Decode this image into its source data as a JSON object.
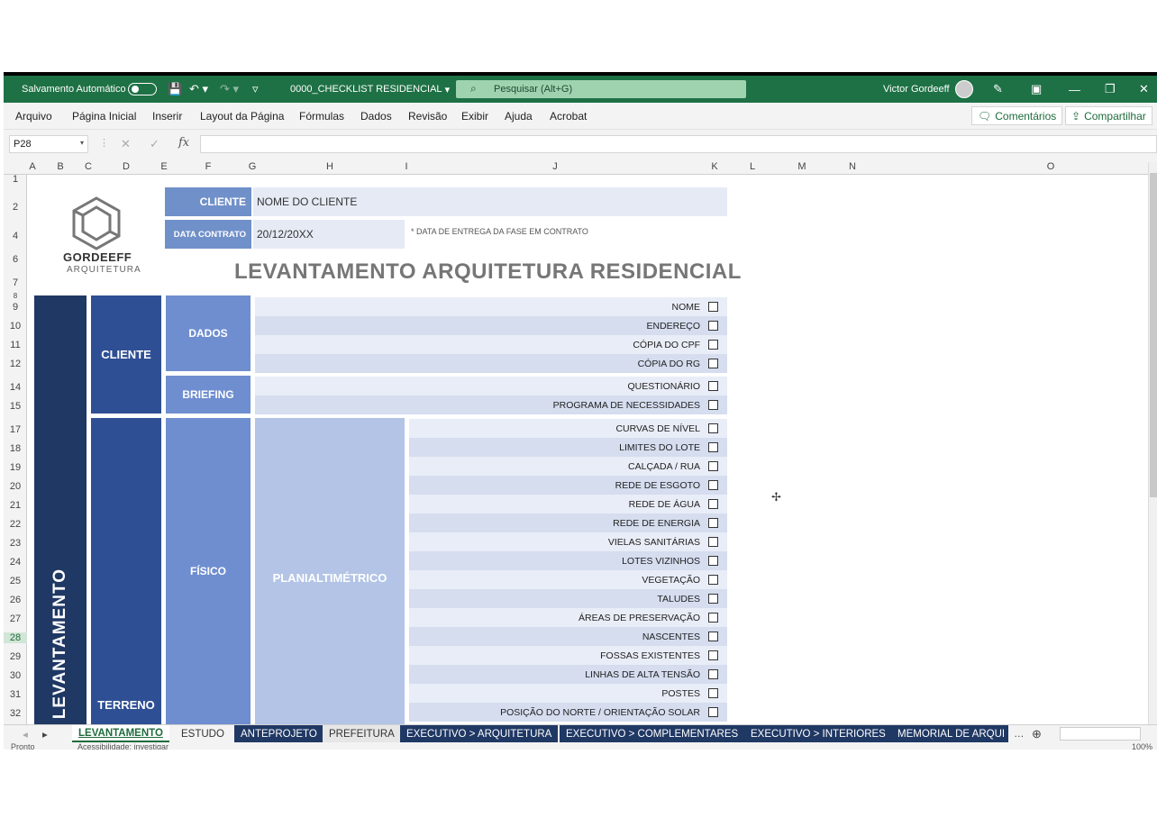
{
  "titlebar": {
    "autosave_label": "Salvamento Automático",
    "filename": "0000_CHECKLIST RESIDENCIAL",
    "filename_caret": "▾",
    "search_placeholder": "Pesquisar (Alt+G)",
    "user_name": "Victor Gordeeff"
  },
  "menu": {
    "items": [
      "Arquivo",
      "Página Inicial",
      "Inserir",
      "Layout da Página",
      "Fórmulas",
      "Dados",
      "Revisão",
      "Exibir",
      "Ajuda",
      "Acrobat"
    ],
    "comments_label": "Comentários",
    "share_label": "Compartilhar"
  },
  "formula_bar": {
    "name_box": "P28",
    "fx_label": "fx",
    "value": ""
  },
  "columns": [
    "A",
    "B",
    "C",
    "D",
    "E",
    "F",
    "G",
    "H",
    "I",
    "J",
    "K",
    "L",
    "M",
    "N",
    "O"
  ],
  "rows": [
    "1",
    "2",
    "4",
    "6",
    "7",
    "8",
    "9",
    "10",
    "11",
    "12",
    "14",
    "15",
    "17",
    "18",
    "19",
    "20",
    "21",
    "22",
    "23",
    "24",
    "25",
    "26",
    "27",
    "28",
    "29",
    "30",
    "31",
    "32"
  ],
  "sheet": {
    "logo_name": "GORDEEFF",
    "logo_sub": "ARQUITETURA",
    "client_label": "CLIENTE",
    "client_value": "NOME DO CLIENTE",
    "date_label": "DATA CONTRATO",
    "date_value": "20/12/20XX",
    "date_note": "* DATA DE ENTREGA DA FASE EM CONTRATO",
    "title": "LEVANTAMENTO ARQUITETURA RESIDENCIAL",
    "phase": "LEVANTAMENTO",
    "group_cliente": "CLIENTE",
    "group_terreno": "TERRENO",
    "sub_dados": "DADOS",
    "sub_briefing": "BRIEFING",
    "sub_fisico": "FÍSICO",
    "sub_planialtimetrico": "PLANIALTIMÉTRICO",
    "dados_items": [
      "NOME",
      "ENDEREÇO",
      "CÓPIA DO CPF",
      "CÓPIA DO RG"
    ],
    "briefing_items": [
      "QUESTIONÁRIO",
      "PROGRAMA DE NECESSIDADES"
    ],
    "fisico_items": [
      "CURVAS DE NÍVEL",
      "LIMITES DO LOTE",
      "CALÇADA / RUA",
      "REDE DE ESGOTO",
      "REDE DE ÁGUA",
      "REDE DE ENERGIA",
      "VIELAS SANITÁRIAS",
      "LOTES VIZINHOS",
      "VEGETAÇÃO",
      "TALUDES",
      "ÁREAS DE PRESERVAÇÃO",
      "NASCENTES",
      "FOSSAS EXISTENTES",
      "LINHAS DE ALTA TENSÃO",
      "POSTES",
      "POSIÇÃO DO NORTE / ORIENTAÇÃO SOLAR"
    ]
  },
  "tabs": [
    "LEVANTAMENTO",
    "ESTUDO",
    "ANTEPROJETO",
    "PREFEITURA",
    "EXECUTIVO > ARQUITETURA",
    "EXECUTIVO > COMPLEMENTARES",
    "EXECUTIVO > INTERIORES",
    "MEMORIAL DE ARQUI"
  ],
  "status": {
    "ready": "Pronto",
    "accessibility": "Acessibilidade: investigar",
    "zoom": "100%"
  },
  "colors": {
    "excel_green": "#1e7145",
    "navy": "#1f3864",
    "blue_dark": "#2f4f94",
    "blue_mid": "#6f8ed0",
    "blue_light": "#b3c4e6"
  }
}
